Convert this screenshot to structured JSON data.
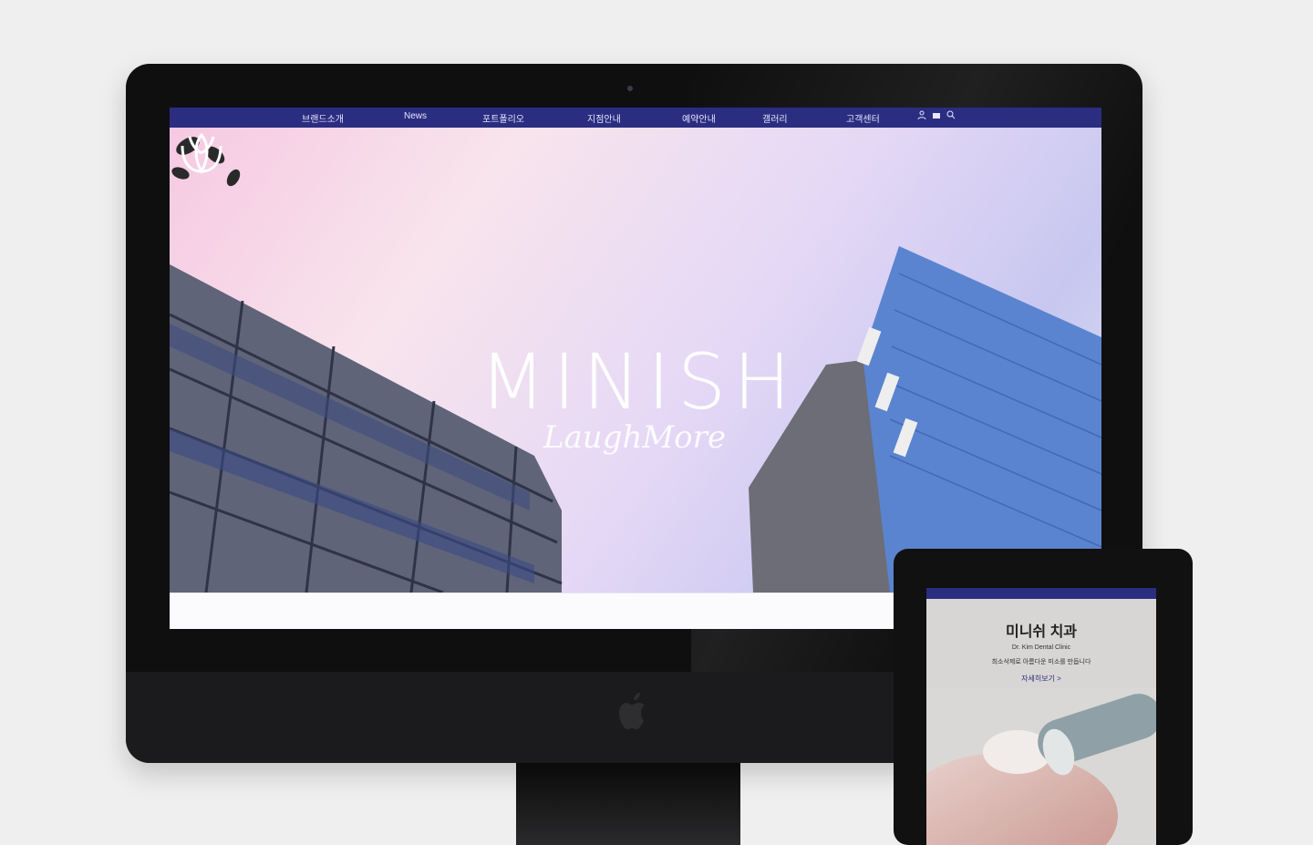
{
  "desktop": {
    "nav": {
      "items": [
        "브랜드소개",
        "News",
        "포트폴리오",
        "지점안내",
        "예약안내",
        "갤러리",
        "고객센터"
      ],
      "icons": [
        "user-icon",
        "cart-icon",
        "search-icon"
      ],
      "bar_color": "#2b2d80"
    },
    "hero": {
      "brand": "MINISH",
      "tagline": "LaughMore"
    }
  },
  "tablet": {
    "title": "미니쉬 치과",
    "lines": [
      "Dr. Kim Dental Clinic",
      "최소삭제로 아름다운 미소를 만듭니다"
    ],
    "link": "자세히보기 >"
  },
  "colors": {
    "accent": "#2b2d80",
    "sky_pink": "#f6c9e2",
    "sky_lavender": "#c8c7f0"
  }
}
